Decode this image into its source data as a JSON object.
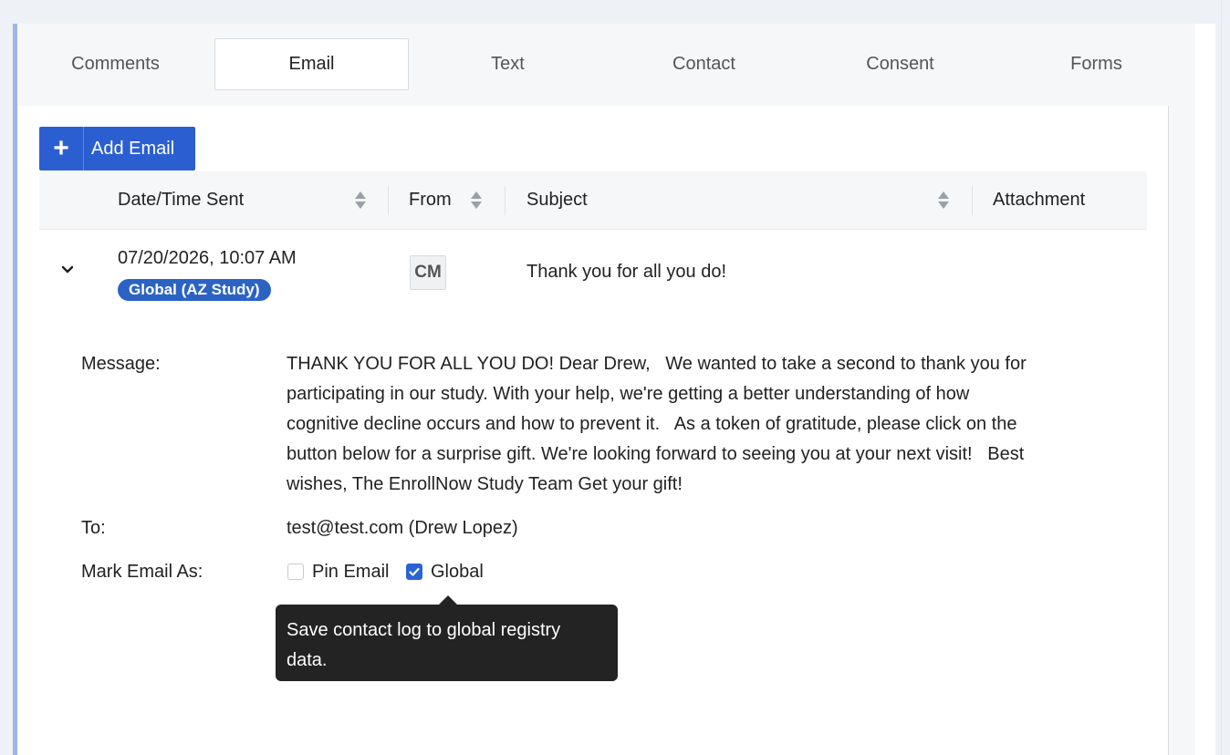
{
  "tabs": [
    "Comments",
    "Email",
    "Text",
    "Contact",
    "Consent",
    "Forms"
  ],
  "active_tab": "Email",
  "toolbar": {
    "add_email_label": "Add Email"
  },
  "table": {
    "headers": {
      "date": "Date/Time Sent",
      "from": "From",
      "subject": "Subject",
      "attachment": "Attachment"
    }
  },
  "row": {
    "date": "07/20/2026, 10:07 AM",
    "badge": "Global (AZ Study)",
    "from_initials": "CM",
    "subject": "Thank you for all you do!"
  },
  "details": {
    "message_label": "Message:",
    "message_lines": [
      "THANK YOU FOR ALL YOU DO! Dear Drew,   We wanted to take a second to thank you for",
      "participating in our study. With your help, we're getting a better understanding of how",
      "cognitive decline occurs and how to prevent it.   As a token of gratitude, please click on the",
      "button below for a surprise gift. We're looking forward to seeing you at your next visit!   Best",
      "wishes, The EnrollNow Study Team Get your gift!"
    ],
    "to_label": "To:",
    "to_value": "test@test.com (Drew Lopez)",
    "mark_label": "Mark Email As:",
    "pin_label": "Pin Email",
    "pin_checked": false,
    "global_label": "Global",
    "global_checked": true
  },
  "tooltip": {
    "lines": [
      "Save contact log to global registry",
      "data."
    ]
  },
  "colors": {
    "accent": "#2b5fd1",
    "badge": "#2b63c4",
    "tooltip_bg": "#232323",
    "frame_border": "#9db5ea"
  }
}
